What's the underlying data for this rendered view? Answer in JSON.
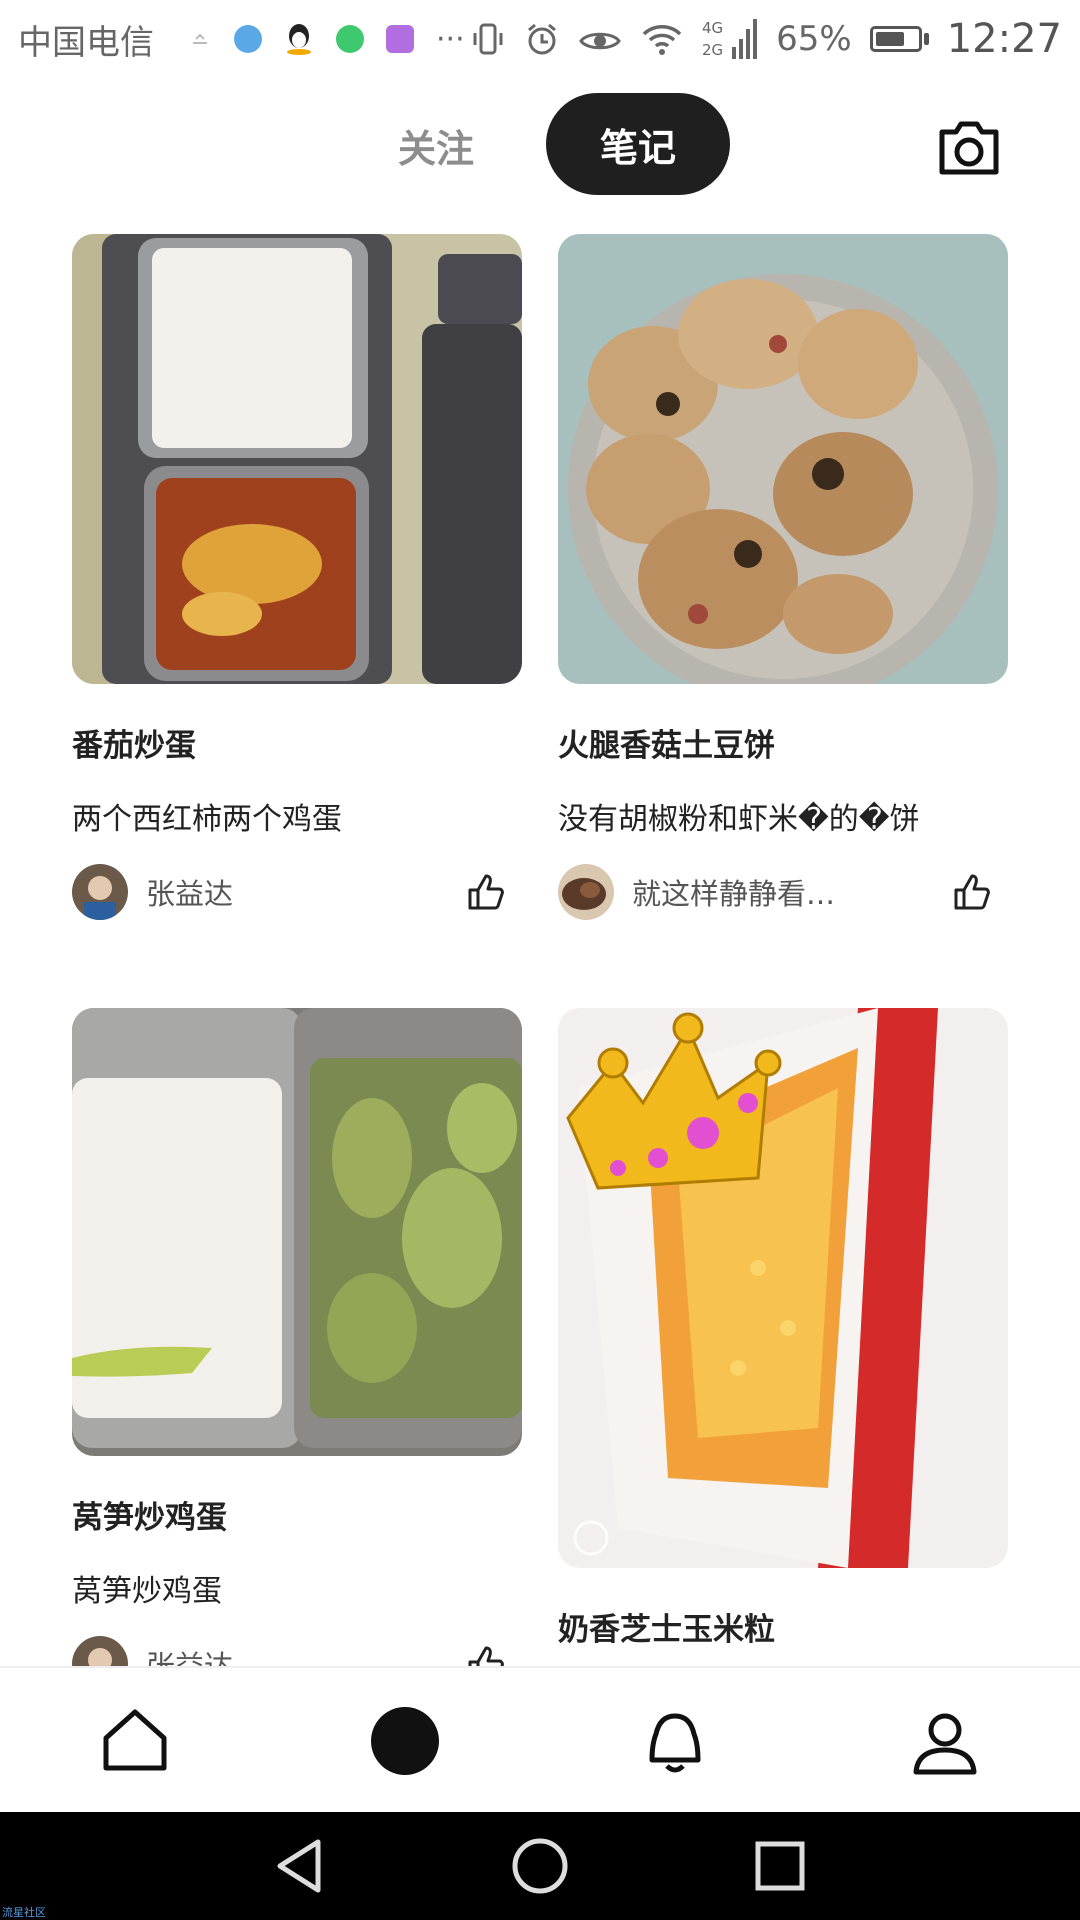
{
  "status_bar": {
    "carrier": "中国电信",
    "signal_label": "4G\n2G",
    "battery": "65%",
    "time": "12:27"
  },
  "header": {
    "tab_follow": "关注",
    "tab_notes": "笔记",
    "active_tab": "笔记",
    "camera_icon": "camera-icon"
  },
  "feed": {
    "cards": [
      {
        "title": "番茄炒蛋",
        "desc": "两个西红柿两个鸡蛋",
        "author": "张益达",
        "image": "tomato-egg-lunchbox-photo"
      },
      {
        "title": "火腿香菇土豆饼",
        "desc": "没有胡椒粉和虾米�的�饼",
        "author": "就这样静静看…",
        "image": "potato-pancakes-plate-photo"
      },
      {
        "title": "莴笋炒鸡蛋",
        "desc": "莴笋炒鸡蛋",
        "author": "张益达",
        "image": "lettuce-rice-lunchbox-photo"
      },
      {
        "title": "奶香芝士玉米粒",
        "desc": "",
        "author": "",
        "image": "cheese-corn-dish-photo"
      }
    ]
  },
  "bottom_tabs": [
    "home-icon",
    "publish-dot-icon",
    "bell-icon",
    "profile-icon"
  ],
  "system_nav": [
    "back-icon",
    "home-circle-icon",
    "recents-icon"
  ],
  "watermark": "流星社区",
  "colors": {
    "accent": "#1f1f1f",
    "muted": "#8d8d8d"
  }
}
